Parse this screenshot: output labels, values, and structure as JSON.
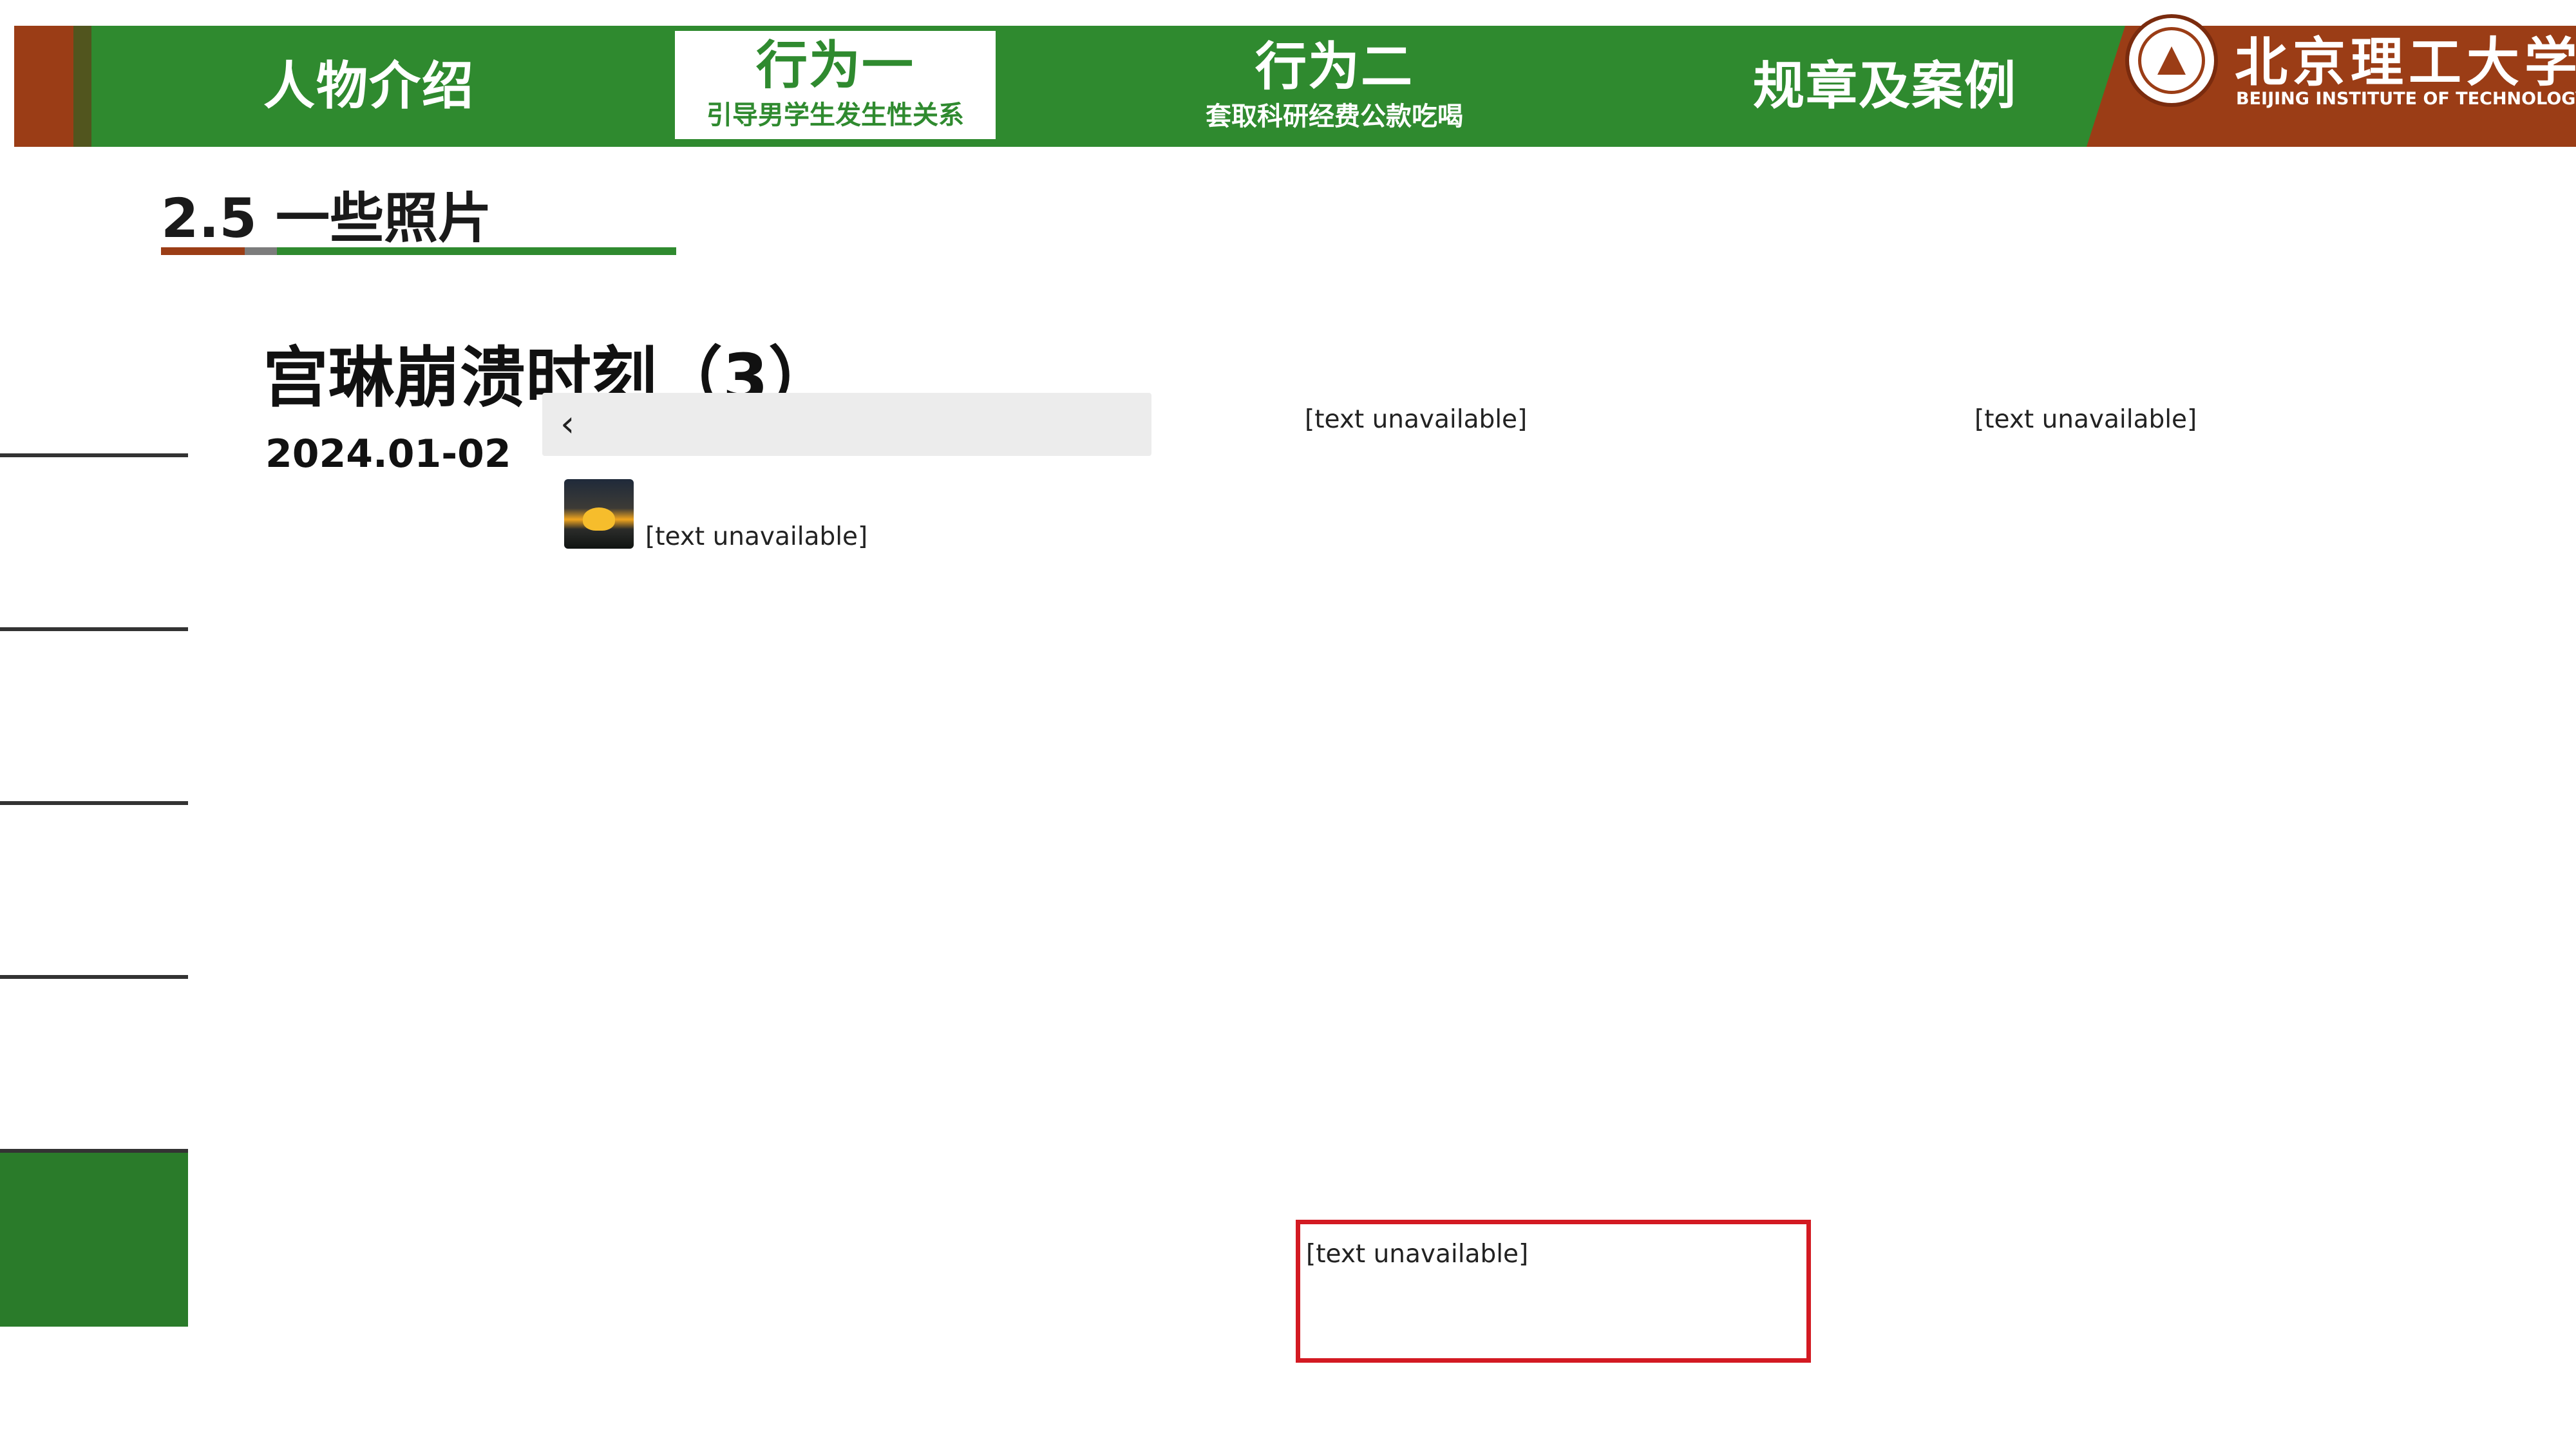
{
  "header": {
    "tabs": [
      {
        "title": "人物介绍",
        "subtitle": ""
      },
      {
        "title": "行为一",
        "subtitle": "引导男学生发生性关系"
      },
      {
        "title": "行为二",
        "subtitle": "套取科研经费公款吃喝"
      },
      {
        "title": "规章及案例",
        "subtitle": ""
      }
    ],
    "university_cn": "北京理工大学",
    "university_en": "BEIJING INSTITUTE OF TECHNOLOGY",
    "brand_green": "#2f8a2f",
    "brand_rust": "#9b3d16"
  },
  "section": {
    "title": "2.5 一些照片"
  },
  "sidebar": {
    "items": [
      {
        "label": "",
        "active": false
      },
      {
        "label": "",
        "active": false
      },
      {
        "label": "",
        "active": false
      },
      {
        "label": "",
        "active": false
      },
      {
        "label": "",
        "active": false
      },
      {
        "label": "",
        "active": true
      }
    ],
    "page_number": ""
  },
  "slide": {
    "title": "宫琳崩溃时刻（3）",
    "date": "2024.01-02"
  },
  "detail": {
    "back_icon": "chevron-left-icon",
    "title": ""
  },
  "post": {
    "username": "",
    "avatar_icon": "sunset-avatar",
    "col1": [
      "[text unavailable]"
    ],
    "col2": [
      "[text unavailable]"
    ],
    "highlight": "[text unavailable]",
    "col3": [
      "[text unavailable]"
    ]
  },
  "caption": {
    "text": "",
    "color": "#d6121c"
  }
}
